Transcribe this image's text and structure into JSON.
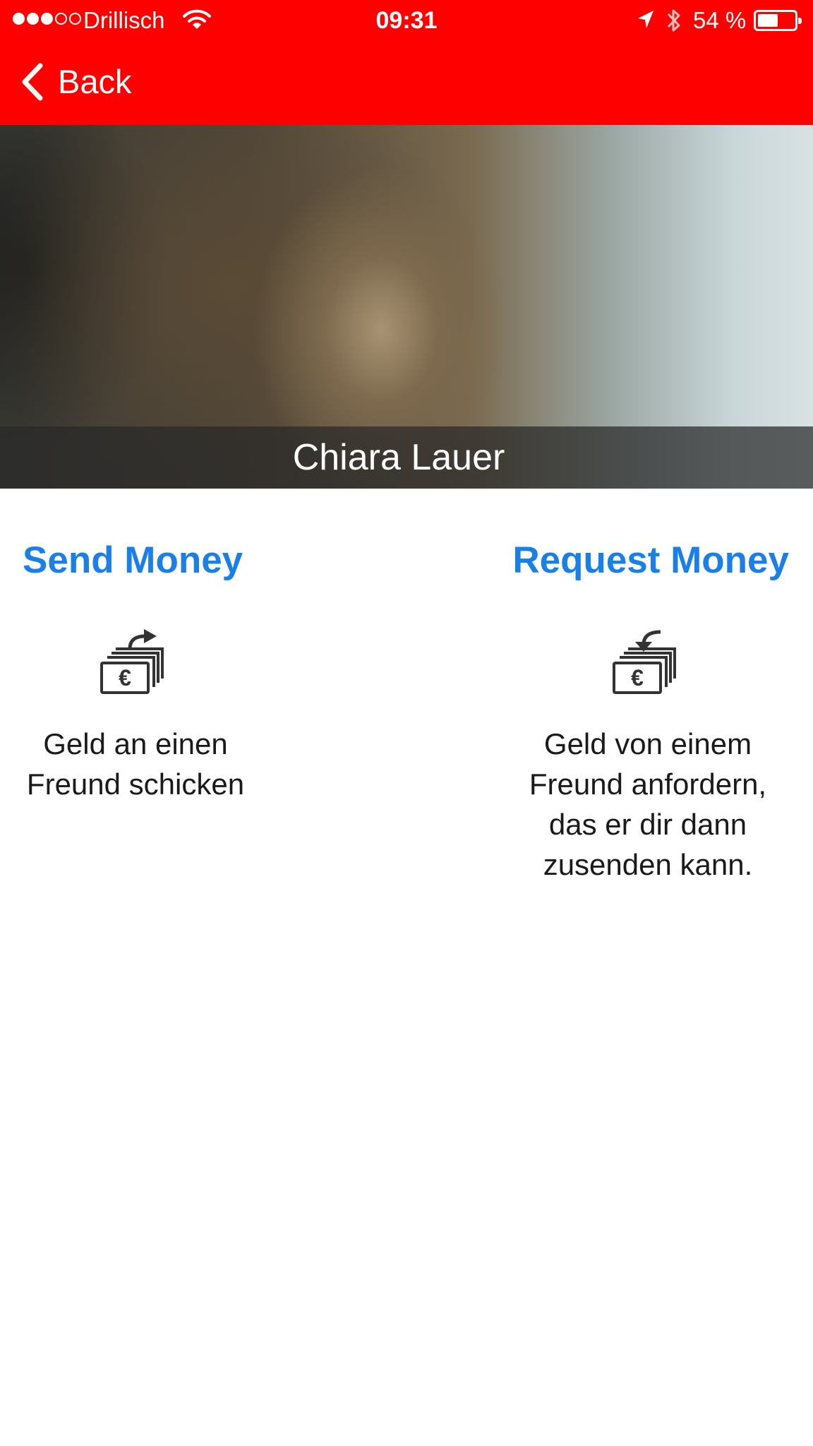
{
  "status_bar": {
    "signal_filled": 3,
    "signal_total": 5,
    "carrier": "Drillisch",
    "time": "09:31",
    "battery": "54 %",
    "battery_level": 0.54
  },
  "nav": {
    "back_label": "Back",
    "bar_color": "#fe0000"
  },
  "profile": {
    "name": "Chiara Lauer"
  },
  "actions": {
    "send": {
      "title": "Send Money",
      "description": "Geld an einen\nFreund schicken",
      "icon": "money-send-icon"
    },
    "request": {
      "title": "Request Money",
      "description": "Geld von einem\nFreund anfordern,\ndas er dir dann\nzusenden kann.",
      "icon": "money-request-icon"
    }
  },
  "colors": {
    "accent": "#1a7fe6",
    "text": "#1a1a1a"
  }
}
